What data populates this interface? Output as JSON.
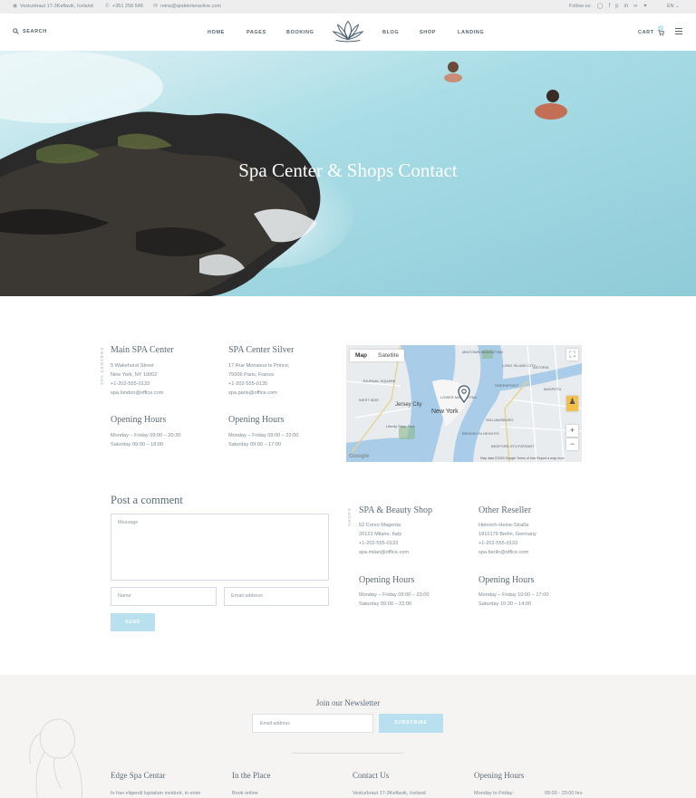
{
  "topbar": {
    "address": "Vesturbraut 17-3Keflavik, Iceland",
    "phone": "+351 258 548",
    "email": "reina@qodeinteractive.com",
    "follow_label": "Follow us:",
    "language": "EN"
  },
  "nav": {
    "search_label": "SEARCH",
    "items": [
      "HOME",
      "PAGES",
      "BOOKING",
      "BLOG",
      "SHOP",
      "LANDING"
    ],
    "cart_label": "CART",
    "cart_count": "0"
  },
  "hero": {
    "title": "Spa Center & Shops Contact"
  },
  "spa_centers": {
    "label": "SPA CENTERS",
    "locations": [
      {
        "name": "Main SPA Center",
        "address": [
          "5 Wakehurst Street",
          "New York, NY 10002",
          "+1-202-555-0133",
          "spa.london@office.com"
        ],
        "hours_title": "Opening Hours",
        "hours": [
          "Monday – Friday 09:00 – 20:30",
          "Saturday 09:00 – 18:00"
        ]
      },
      {
        "name": "SPA Center Silver",
        "address": [
          "17 Rue Monsieur le Prince,",
          "75006 Paris, France",
          "+1-202-555-0135",
          "spa.paris@office.com"
        ],
        "hours_title": "Opening Hours",
        "hours": [
          "Monday – Friday 09:00 – 22:00",
          "Saturday 09:00 – 17:00"
        ]
      }
    ]
  },
  "map": {
    "tab_map": "Map",
    "tab_satellite": "Satellite",
    "city_label": "New York",
    "labels": [
      "Jersey City",
      "LONG ISLAND CITY",
      "GREENPOINT",
      "WILLIAMSBURG",
      "MIDTOWN MANHATTAN",
      "ASTORIA",
      "JOURNAL SQUARE",
      "WEST SIDE",
      "LOWER MANHATTAN",
      "BROOKLYN HEIGHTS",
      "BEDFORD-STUYVESANT",
      "Liberty State Park",
      "MASPETH"
    ],
    "credit": "Map data ©2020 Google   Terms of Use   Report a map error",
    "google": "Google",
    "zoom_in": "+",
    "zoom_out": "−"
  },
  "comment": {
    "title": "Post a comment",
    "message_placeholder": "Message",
    "name_placeholder": "Name",
    "email_placeholder": "Email address",
    "send_label": "SEND"
  },
  "shops": {
    "label": "SHOPS",
    "locations": [
      {
        "name": "SPA & Beauty Shop",
        "address": [
          "52 Corso Magenta",
          "20123 Milano, Italy",
          "+1-202-555-0133",
          "spa.milan@office.com"
        ],
        "hours_title": "Opening Hours",
        "hours": [
          "Monday – Friday 09:00 – 23:00",
          "Saturday 09:00 – 22:00"
        ]
      },
      {
        "name": "Other Reseller",
        "address": [
          "Heinrich-Heine-Straße",
          "1810179 Berlin, Germany",
          "+1-202-555-0133",
          "spa.berlin@office.com"
        ],
        "hours_title": "Opening Hours",
        "hours": [
          "Monday – Friday 10:00 – 17:00",
          "Saturday 10:30 – 14:00"
        ]
      }
    ]
  },
  "newsletter": {
    "title": "Join our Newsletter",
    "email_placeholder": "Email address",
    "button_label": "SUBSCRIBE"
  },
  "footer": {
    "columns": [
      {
        "title": "Edge Spa Centar",
        "text": "In has eligendi luptatum invidunt, in enim"
      },
      {
        "title": "In the Place",
        "text": "Book online"
      },
      {
        "title": "Contact Us",
        "text": "Vesturbraut 17-3Keflavik, Iceland"
      },
      {
        "title": "Opening Hours",
        "text": "Monday to Friday:",
        "value": "09:00 - 20:00 hrs"
      }
    ]
  },
  "colors": {
    "accent": "#b9e0ee",
    "heading": "#5b6b77",
    "text": "#7d8a94",
    "footer_bg": "#f5f4f3",
    "topbar_bg": "#eeeeee"
  },
  "icons": {
    "address": "location-pin-icon",
    "phone": "phone-icon",
    "email": "envelope-icon",
    "social": [
      "instagram-icon",
      "facebook-icon",
      "pinterest-icon",
      "linkedin-icon",
      "tripadvisor-icon",
      "twitter-icon"
    ],
    "search": "search-icon",
    "cart": "cart-icon",
    "menu": "hamburger-icon"
  }
}
